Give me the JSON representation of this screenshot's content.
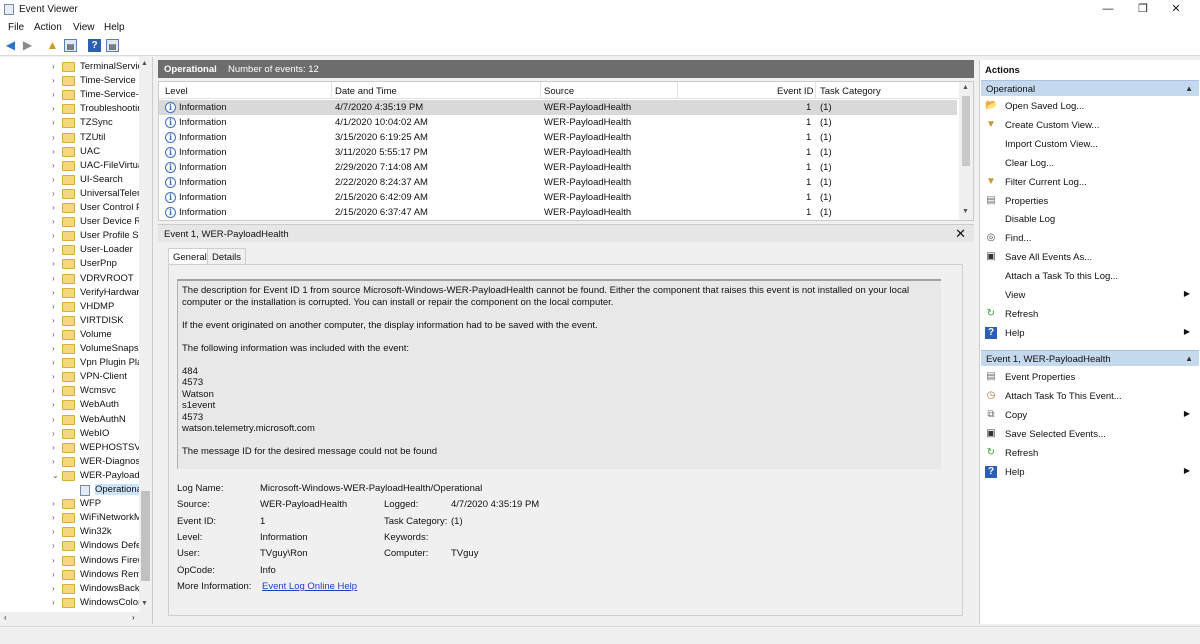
{
  "window": {
    "title": "Event Viewer"
  },
  "menu": [
    "File",
    "Action",
    "View",
    "Help"
  ],
  "tree": {
    "items": [
      "TerminalServic",
      "Time-Service",
      "Time-Service-F",
      "Troubleshootir",
      "TZSync",
      "TZUtil",
      "UAC",
      "UAC-FileVirtua",
      "UI-Search",
      "UniversalTelem",
      "User Control Pa",
      "User Device Re",
      "User Profile Ser",
      "User-Loader",
      "UserPnp",
      "VDRVROOT",
      "VerifyHardware",
      "VHDMP",
      "VIRTDISK",
      "Volume",
      "VolumeSnapsh",
      "Vpn Plugin Pla",
      "VPN-Client",
      "Wcmsvc",
      "WebAuth",
      "WebAuthN",
      "WebIO",
      "WEPHOSTSVC",
      "WER-Diagnost",
      "WER-PayloadH"
    ],
    "child": "Operationa",
    "items_after": [
      "WFP",
      "WiFiNetworkM",
      "Win32k",
      "Windows Defe",
      "Windows Firew",
      "Windows Remo",
      "WindowsBacku",
      "WindowsColor"
    ]
  },
  "log": {
    "name": "Operational",
    "count_label": "Number of events: 12",
    "columns": [
      "Level",
      "Date and Time",
      "Source",
      "Event ID",
      "Task Category"
    ],
    "rows": [
      {
        "level": "Information",
        "date": "4/7/2020 4:35:19 PM",
        "source": "WER-PayloadHealth",
        "id": "1",
        "task": "(1)"
      },
      {
        "level": "Information",
        "date": "4/1/2020 10:04:02 AM",
        "source": "WER-PayloadHealth",
        "id": "1",
        "task": "(1)"
      },
      {
        "level": "Information",
        "date": "3/15/2020 6:19:25 AM",
        "source": "WER-PayloadHealth",
        "id": "1",
        "task": "(1)"
      },
      {
        "level": "Information",
        "date": "3/11/2020 5:55:17 PM",
        "source": "WER-PayloadHealth",
        "id": "1",
        "task": "(1)"
      },
      {
        "level": "Information",
        "date": "2/29/2020 7:14:08 AM",
        "source": "WER-PayloadHealth",
        "id": "1",
        "task": "(1)"
      },
      {
        "level": "Information",
        "date": "2/22/2020 8:24:37 AM",
        "source": "WER-PayloadHealth",
        "id": "1",
        "task": "(1)"
      },
      {
        "level": "Information",
        "date": "2/15/2020 6:42:09 AM",
        "source": "WER-PayloadHealth",
        "id": "1",
        "task": "(1)"
      },
      {
        "level": "Information",
        "date": "2/15/2020 6:37:47 AM",
        "source": "WER-PayloadHealth",
        "id": "1",
        "task": "(1)"
      }
    ]
  },
  "detail": {
    "title": "Event 1, WER-PayloadHealth",
    "tabs": [
      "General",
      "Details"
    ],
    "description": [
      "The description for Event ID 1 from source Microsoft-Windows-WER-PayloadHealth cannot be found. Either the component that raises this event is not installed on your local computer or the installation is corrupted. You can install or repair the component on the local computer.",
      "",
      "If the event originated on another computer, the display information had to be saved with the event.",
      "",
      "The following information was included with the event:",
      "",
      "484",
      "4573",
      "Watson",
      "s1event",
      "4573",
      "watson.telemetry.microsoft.com",
      "",
      "The message ID for the desired message could not be found"
    ],
    "props": {
      "log_name_label": "Log Name:",
      "log_name": "Microsoft-Windows-WER-PayloadHealth/Operational",
      "source_label": "Source:",
      "source": "WER-PayloadHealth",
      "logged_label": "Logged:",
      "logged": "4/7/2020 4:35:19 PM",
      "event_id_label": "Event ID:",
      "event_id": "1",
      "task_label": "Task Category:",
      "task": "(1)",
      "level_label": "Level:",
      "level": "Information",
      "keywords_label": "Keywords:",
      "user_label": "User:",
      "user": "TVguy\\Ron",
      "computer_label": "Computer:",
      "computer": "TVguy",
      "opcode_label": "OpCode:",
      "opcode": "Info",
      "more_label": "More Information:",
      "more_link": "Event Log Online Help"
    }
  },
  "actions": {
    "title": "Actions",
    "section1": "Operational",
    "items1": [
      {
        "label": "Open Saved Log...",
        "icon": "folder-open-icon"
      },
      {
        "label": "Create Custom View...",
        "icon": "filter-icon"
      },
      {
        "label": "Import Custom View...",
        "icon": ""
      },
      {
        "label": "Clear Log...",
        "icon": ""
      },
      {
        "label": "Filter Current Log...",
        "icon": "filter-icon"
      },
      {
        "label": "Properties",
        "icon": "properties-icon"
      },
      {
        "label": "Disable Log",
        "icon": ""
      },
      {
        "label": "Find...",
        "icon": "binoculars-icon"
      },
      {
        "label": "Save All Events As...",
        "icon": "save-icon"
      },
      {
        "label": "Attach a Task To this Log...",
        "icon": ""
      },
      {
        "label": "View",
        "icon": "",
        "sub": true
      },
      {
        "label": "Refresh",
        "icon": "refresh-icon"
      },
      {
        "label": "Help",
        "icon": "help-icon",
        "sub": true
      }
    ],
    "section2": "Event 1, WER-PayloadHealth",
    "items2": [
      {
        "label": "Event Properties",
        "icon": "properties-icon"
      },
      {
        "label": "Attach Task To This Event...",
        "icon": "task-icon"
      },
      {
        "label": "Copy",
        "icon": "copy-icon",
        "sub": true
      },
      {
        "label": "Save Selected Events...",
        "icon": "save-icon"
      },
      {
        "label": "Refresh",
        "icon": "refresh-icon"
      },
      {
        "label": "Help",
        "icon": "help-icon",
        "sub": true
      }
    ]
  }
}
